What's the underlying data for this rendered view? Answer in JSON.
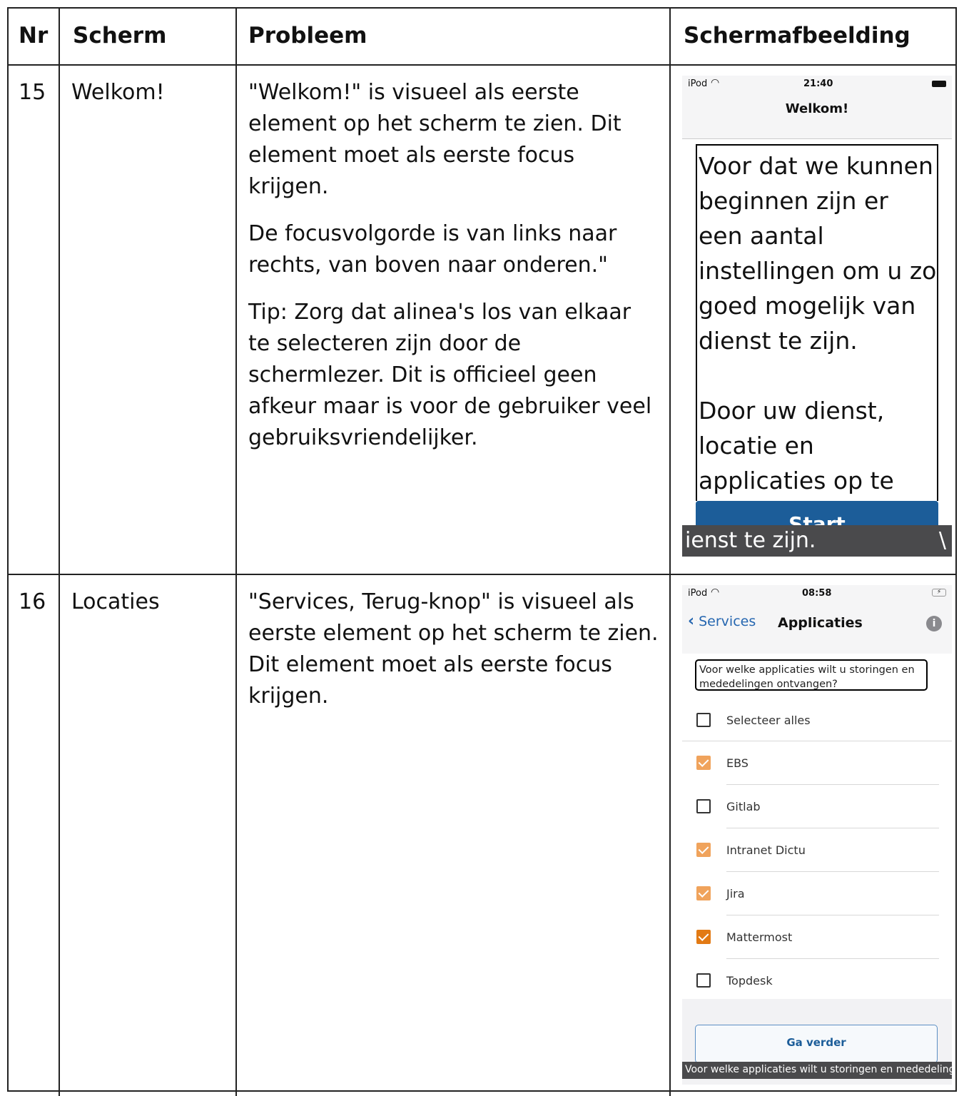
{
  "table": {
    "headers": {
      "nr": "Nr",
      "screen": "Scherm",
      "problem": "Probleem",
      "screenshot": "Schermafbeelding"
    },
    "rows": [
      {
        "nr": "15",
        "screen": "Welkom!",
        "problem": [
          "\"Welkom!\" is visueel als eerste element op het scherm te zien. Dit element moet als eerste focus krijgen.",
          "De focusvolgorde is van links naar rechts, van boven naar onderen.\"",
          "Tip: Zorg dat alinea's los van elkaar te selecteren zijn door de schermlezer. Dit is officieel geen afkeur maar is voor de gebruiker veel gebruiksvriendelijker."
        ],
        "shot": {
          "carrier": "iPod",
          "time": "21:40",
          "title": "Welkom!",
          "body": "Voor dat we kunnen beginnen zijn er een aantal instellingen om u zo goed mogelijk van dienst te zijn.",
          "body2": "Door uw dienst, locatie en applicaties op te",
          "start_button": "Start",
          "caption": "ienst te zijn."
        }
      },
      {
        "nr": "16",
        "screen": "Locaties",
        "problem": [
          "\"Services, Terug-knop\" is visueel als eerste element op het scherm te zien. Dit element moet als eerste focus krijgen."
        ],
        "shot": {
          "carrier": "iPod",
          "time": "08:58",
          "back_label": "Services",
          "title": "Applicaties",
          "question": "Voor welke applicaties wilt u storingen en mededelingen ontvangen?",
          "select_all": "Selecteer alles",
          "items": [
            {
              "label": "EBS",
              "checked": true
            },
            {
              "label": "Gitlab",
              "checked": false
            },
            {
              "label": "Intranet Dictu",
              "checked": true
            },
            {
              "label": "Jira",
              "checked": true
            },
            {
              "label": "Mattermost",
              "checked": true
            },
            {
              "label": "Topdesk",
              "checked": false
            }
          ],
          "continue_button": "Ga verder",
          "caption": "Voor welke applicaties wilt u storingen en mededeling"
        }
      }
    ]
  }
}
